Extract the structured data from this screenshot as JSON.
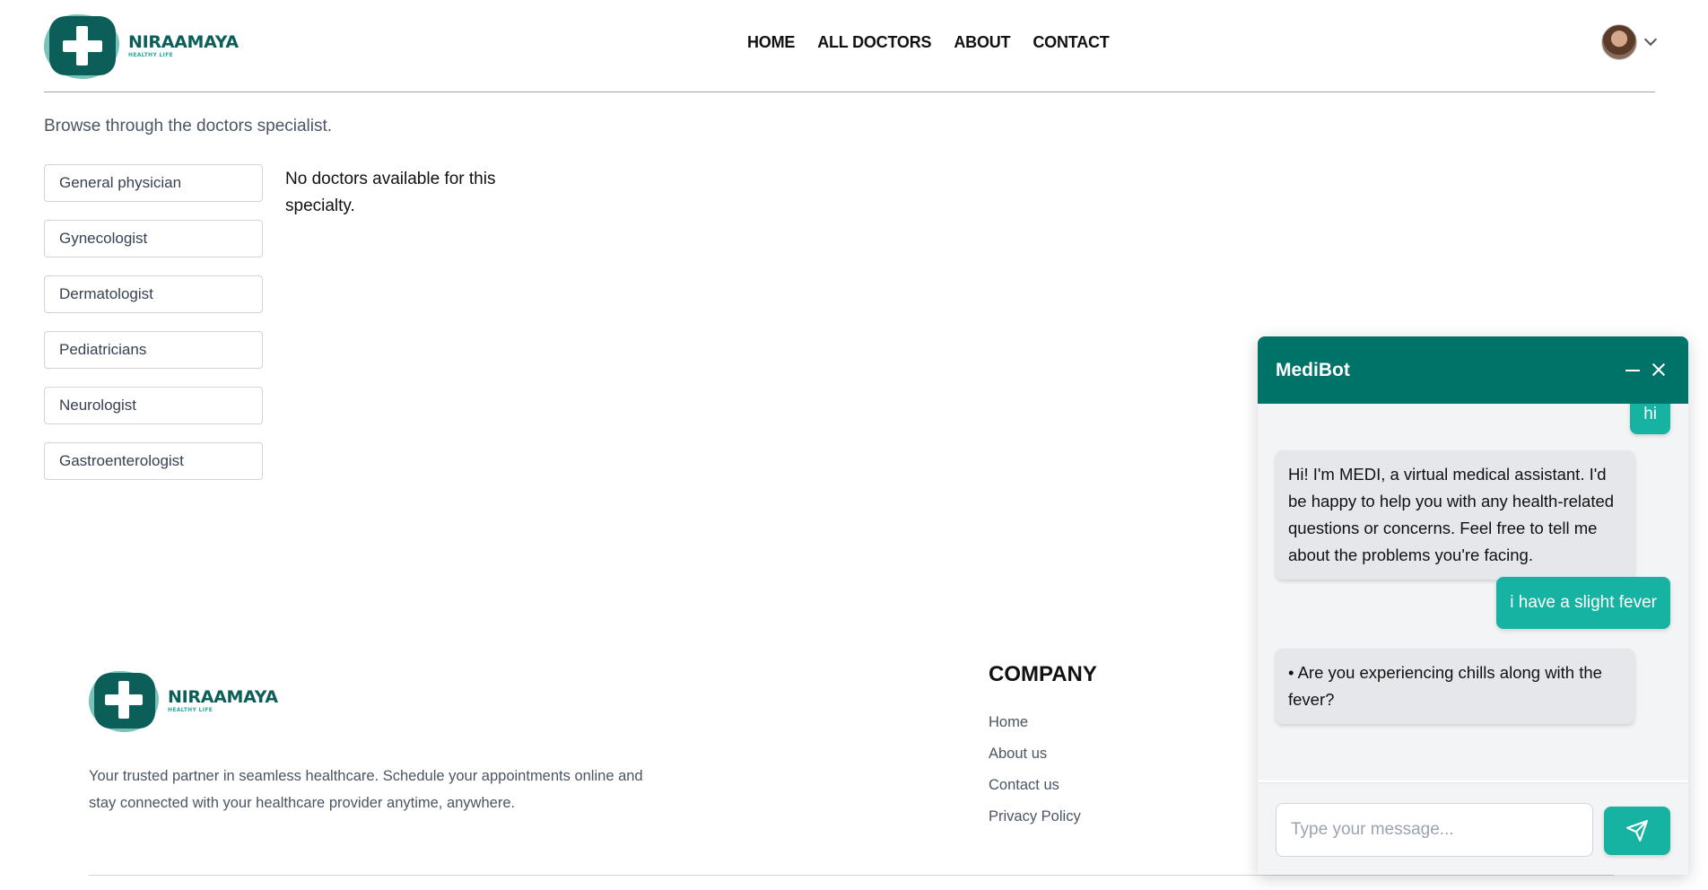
{
  "brand": {
    "name": "NIRAAMAYA",
    "tagline": "HEALTHY LIFE"
  },
  "nav": {
    "items": [
      "HOME",
      "ALL DOCTORS",
      "ABOUT",
      "CONTACT"
    ]
  },
  "main": {
    "intro": "Browse through the doctors specialist.",
    "specialties": [
      "General physician",
      "Gynecologist",
      "Dermatologist",
      "Pediatricians",
      "Neurologist",
      "Gastroenterologist"
    ],
    "empty_message": "No doctors available for this specialty."
  },
  "footer": {
    "description": "Your trusted partner in seamless healthcare. Schedule your appointments online and stay connected with your healthcare provider anytime, anywhere.",
    "company_title": "COMPANY",
    "links": [
      "Home",
      "About us",
      "Contact us",
      "Privacy Policy"
    ]
  },
  "chat": {
    "title": "MediBot",
    "messages": [
      {
        "from": "user",
        "text": "hi"
      },
      {
        "from": "bot",
        "text": "Hi! I'm MEDI, a virtual medical assistant. I'd be happy to help you with any health-related questions or concerns. Feel free to tell me about the problems you're facing."
      },
      {
        "from": "user",
        "text": "i have a slight fever"
      },
      {
        "from": "bot",
        "text": "• Are you experiencing chills along with the fever?"
      }
    ],
    "input_placeholder": "Type your message..."
  },
  "colors": {
    "brand": "#0b5f58",
    "header": "#007369",
    "accent": "#16b2a2"
  }
}
